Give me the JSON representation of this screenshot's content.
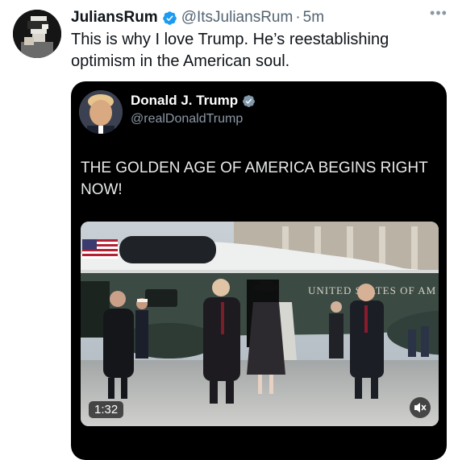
{
  "tweet": {
    "display_name": "JuliansRum",
    "handle": "@ItsJuliansRum",
    "separator": "·",
    "time": "5m",
    "more_label": "•••",
    "text": "This is why I love Trump. He’s reestablishing optimism in the American soul."
  },
  "quoted": {
    "display_name": "Donald J. Trump",
    "handle": "@realDonaldTrump",
    "text": "THE GOLDEN AGE OF AMERICA BEGINS RIGHT NOW!",
    "video": {
      "duration": "1:32",
      "aircraft_text": "UNITED STATES OF AM"
    }
  },
  "colors": {
    "verified": "#1d9bf0",
    "quote_background": "#000000",
    "secondary_text": "#536471"
  }
}
